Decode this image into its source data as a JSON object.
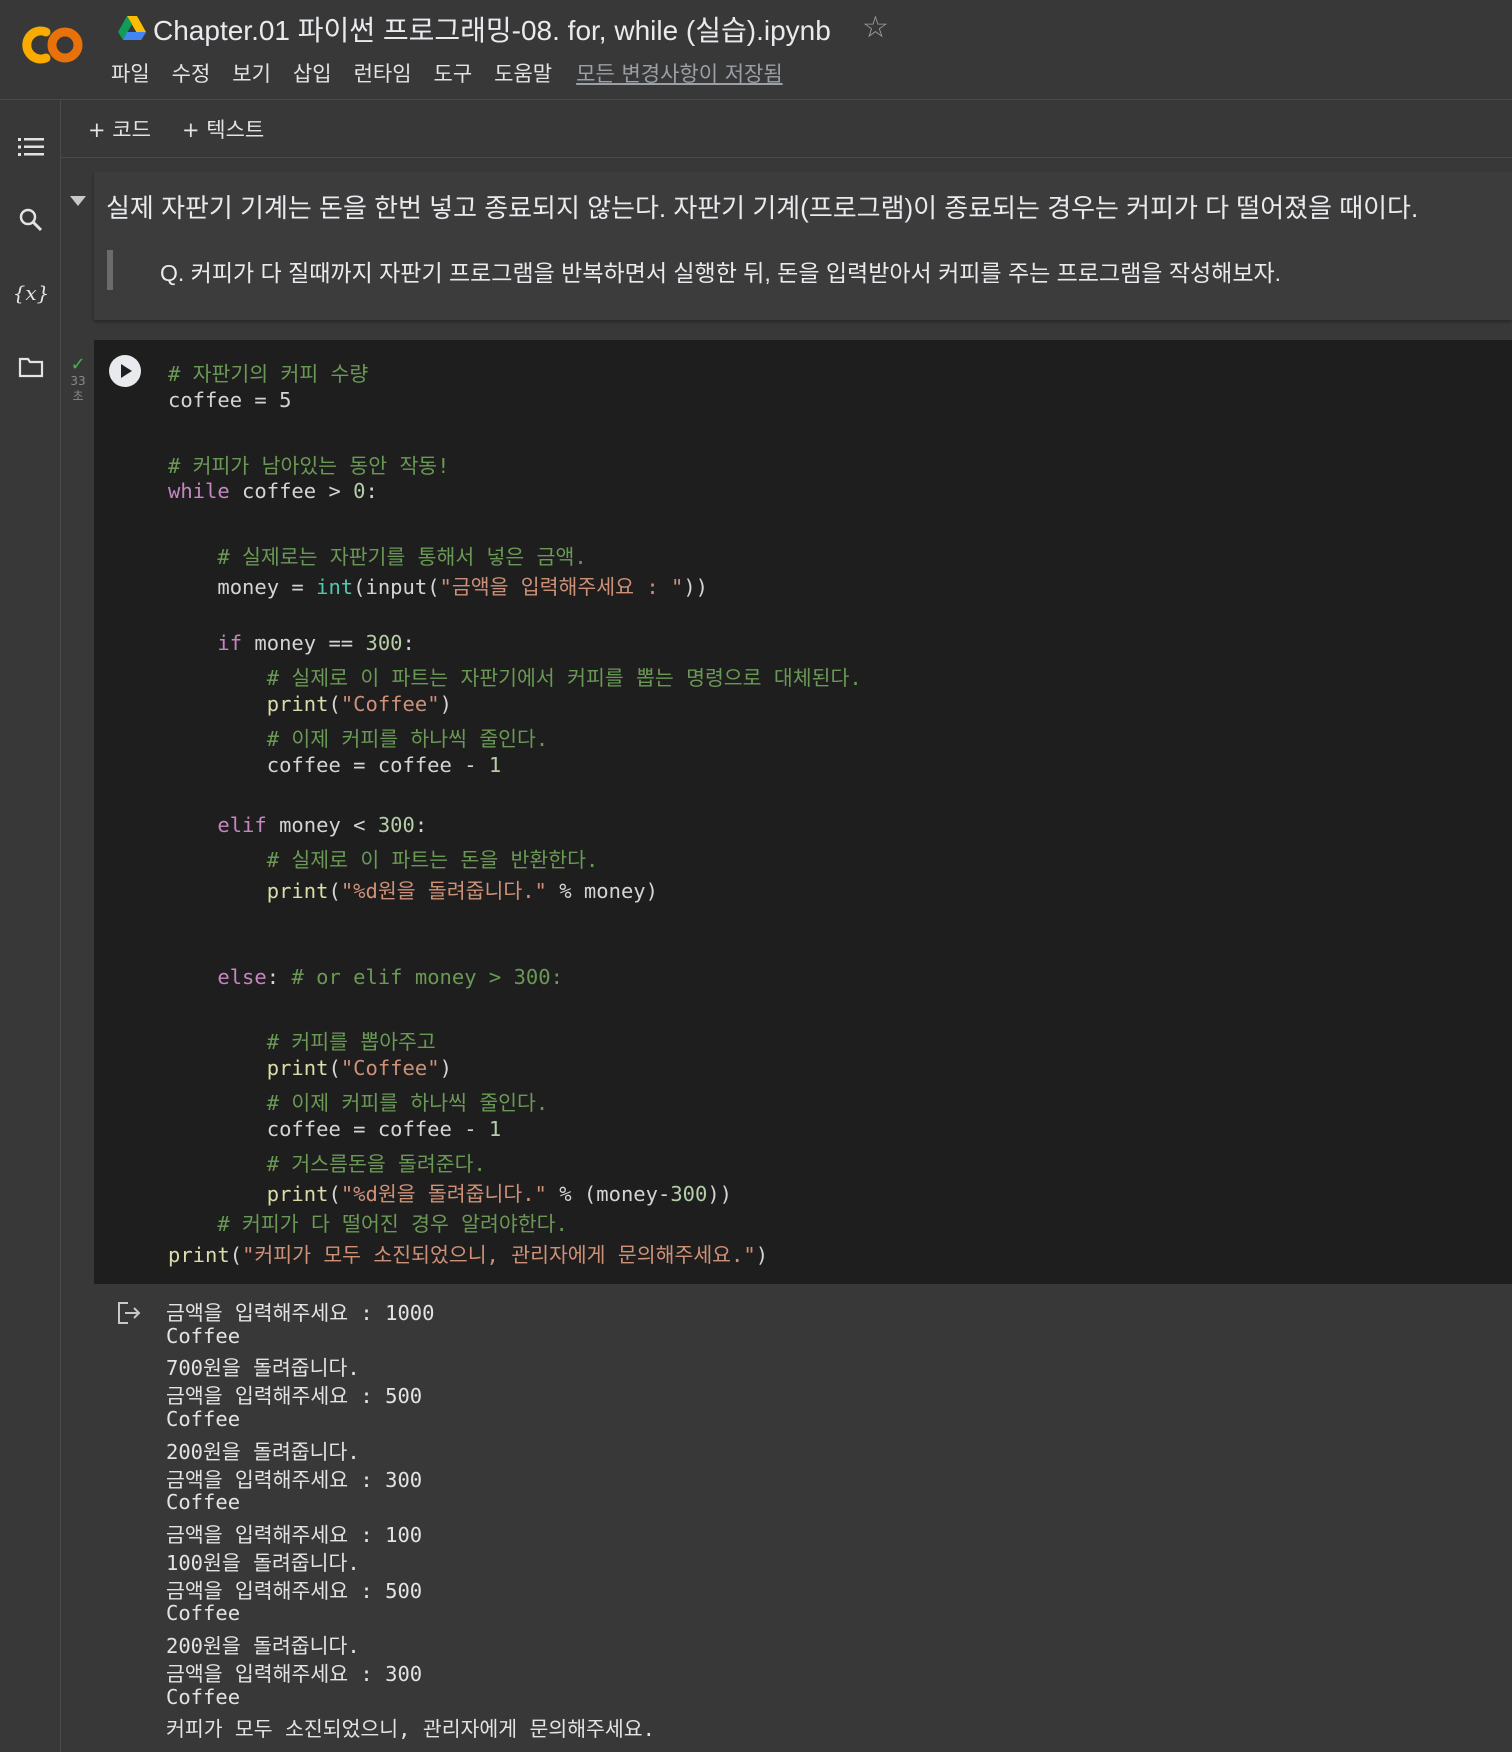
{
  "app": {
    "title": "Chapter.01 파이썬 프로그래밍-08. for, while (실습).ipynb",
    "star_icon": "star-outline-icon"
  },
  "menu": {
    "items": [
      "파일",
      "수정",
      "보기",
      "삽입",
      "런타임",
      "도구",
      "도움말"
    ],
    "saved_status": "모든 변경사항이 저장됨"
  },
  "toolbar": {
    "add_code": "+ 코드",
    "add_text": "+ 텍스트"
  },
  "sidebar": {
    "icons": [
      "toc-icon",
      "search-icon",
      "variables-icon",
      "folder-icon"
    ],
    "variables_label": "{x}"
  },
  "text_cell": {
    "line1": "실제 자판기 기계는 돈을 한번 넣고 종료되지 않는다. 자판기 기계(프로그램)이 종료되는 경우는 커피가 다 떨어졌을 때이다.",
    "line2": "Q. 커피가 다 질때까지 자판기 프로그램을 반복하면서 실행한 뒤, 돈을 입력받아서 커피를 주는 프로그램을 작성해보자."
  },
  "code_cell": {
    "exec_time_value": "33",
    "exec_time_unit": "초",
    "lines": [
      "# 자판기의 커피 수량",
      "coffee = 5",
      "",
      "# 커피가 남아있는 동안 작동!",
      "while coffee > 0:",
      "",
      "    # 실제로는 자판기를 통해서 넣은 금액.",
      "    money = int(input(\"금액을 입력해주세요 : \"))",
      "",
      "    if money == 300:",
      "        # 실제로 이 파트는 자판기에서 커피를 뽑는 명령으로 대체된다.",
      "        print(\"Coffee\")",
      "        # 이제 커피를 하나씩 줄인다.",
      "        coffee = coffee - 1",
      "",
      "    elif money < 300:",
      "        # 실제로 이 파트는 돈을 반환한다.",
      "        print(\"%d원을 돌려줍니다.\" % money)",
      "",
      "",
      "    else: # or elif money > 300:",
      "",
      "        # 커피를 뽑아주고",
      "        print(\"Coffee\")",
      "        # 이제 커피를 하나씩 줄인다.",
      "        coffee = coffee - 1",
      "        # 거스름돈을 돌려준다.",
      "        print(\"%d원을 돌려줍니다.\" % (money-300))",
      "    # 커피가 다 떨어진 경우 알려야한다.",
      "print(\"커피가 모두 소진되었으니, 관리자에게 문의해주세요.\")"
    ]
  },
  "output": {
    "lines": [
      "금액을 입력해주세요 : 1000",
      "Coffee",
      "700원을 돌려줍니다.",
      "금액을 입력해주세요 : 500",
      "Coffee",
      "200원을 돌려줍니다.",
      "금액을 입력해주세요 : 300",
      "Coffee",
      "금액을 입력해주세요 : 100",
      "100원을 돌려줍니다.",
      "금액을 입력해주세요 : 500",
      "Coffee",
      "200원을 돌려줍니다.",
      "금액을 입력해주세요 : 300",
      "Coffee",
      "커피가 모두 소진되었으니, 관리자에게 문의해주세요."
    ]
  }
}
